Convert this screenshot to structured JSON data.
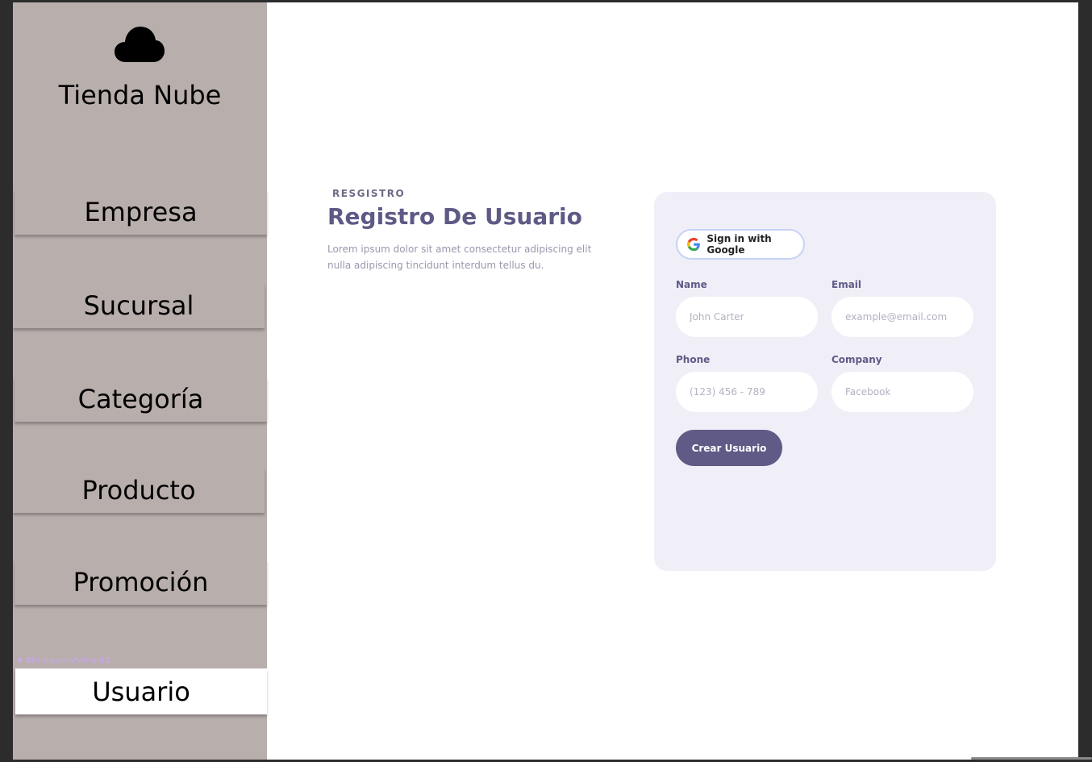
{
  "brand": {
    "name": "Tienda Nube",
    "icon": "cloud-icon"
  },
  "nav": {
    "items": [
      {
        "label": "Empresa"
      },
      {
        "label": "Sucursal"
      },
      {
        "label": "Categoría"
      },
      {
        "label": "Producto"
      },
      {
        "label": "Promoción"
      },
      {
        "label": "Usuario",
        "active": true
      }
    ],
    "variant_label": "❖ Btn-Usuario/Variant3"
  },
  "page": {
    "kicker": "RESGISTRO",
    "title": "Registro De Usuario",
    "description": "Lorem ipsum dolor sit amet consectetur adipiscing elit nulla adipiscing tincidunt interdum tellus du."
  },
  "form": {
    "google_label": "Sign in with Google",
    "fields": {
      "name": {
        "label": "Name",
        "placeholder": "John Carter"
      },
      "email": {
        "label": "Email",
        "placeholder": "example@email.com"
      },
      "phone": {
        "label": "Phone",
        "placeholder": "(123) 456 - 789"
      },
      "company": {
        "label": "Company",
        "placeholder": "Facebook"
      }
    },
    "submit_label": "Crear Usuario"
  },
  "colors": {
    "sidebar": "#b8aeac",
    "accent": "#5f5a86",
    "card": "#f0eff8"
  }
}
